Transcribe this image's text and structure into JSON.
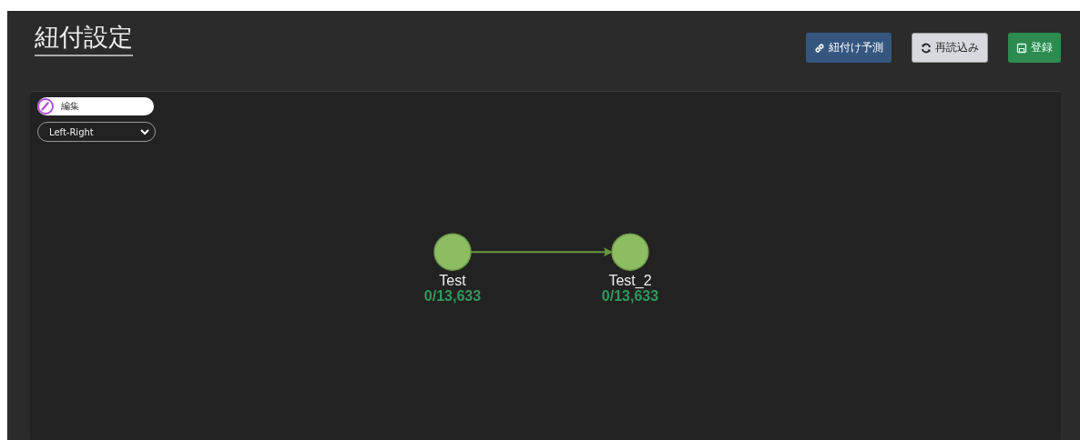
{
  "page": {
    "title": "紐付設定"
  },
  "buttons": [
    {
      "kind": "predict",
      "label": "紐付け予測"
    },
    {
      "kind": "reload",
      "label": "再読込み"
    },
    {
      "kind": "save",
      "label": "登録"
    }
  ],
  "edit_toggle": {
    "label": "編集",
    "on": false
  },
  "layout_select": {
    "value": "Left-Right"
  },
  "graph": {
    "nodes": [
      {
        "name": "Test",
        "count": "0/13,633"
      },
      {
        "name": "Test_2",
        "count": "0/13,633"
      }
    ],
    "edges": [
      {
        "kind": "arrow"
      }
    ]
  }
}
